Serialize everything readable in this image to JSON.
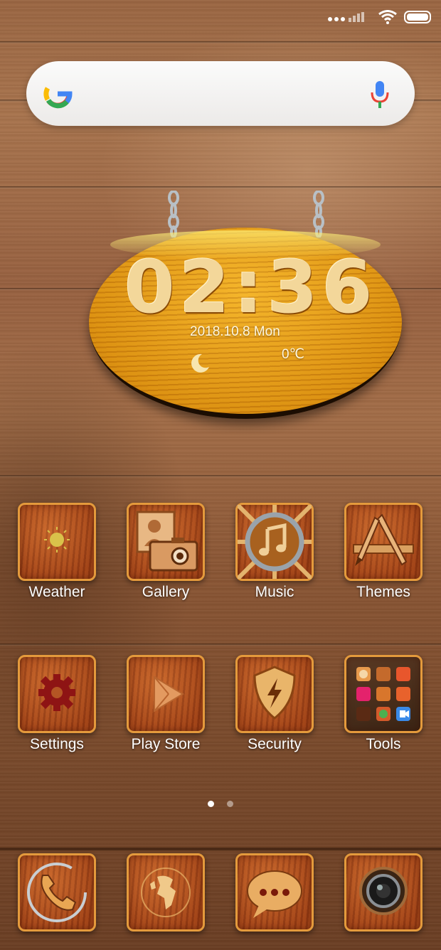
{
  "search": {
    "logo": "google-g-icon",
    "mic": "mic-icon"
  },
  "clock": {
    "time": "02:36",
    "date": "2018.10.8 Mon",
    "temperature": "0℃",
    "weather_icon": "moon-icon"
  },
  "apps_row1": [
    {
      "label": "Weather",
      "icon": "sun-icon"
    },
    {
      "label": "Gallery",
      "icon": "photo-camera-icon"
    },
    {
      "label": "Music",
      "icon": "music-note-icon"
    },
    {
      "label": "Themes",
      "icon": "brush-ruler-icon"
    }
  ],
  "apps_row2": [
    {
      "label": "Settings",
      "icon": "gear-icon"
    },
    {
      "label": "Play Store",
      "icon": "play-icon"
    },
    {
      "label": "Security",
      "icon": "shield-bolt-icon"
    },
    {
      "label": "Tools",
      "icon": "folder-icon"
    }
  ],
  "dock": [
    {
      "icon": "phone-icon"
    },
    {
      "icon": "browser-globe-icon"
    },
    {
      "icon": "messages-icon"
    },
    {
      "icon": "camera-icon"
    }
  ],
  "page_indicator": {
    "pages": 2,
    "active": 1
  },
  "colors": {
    "tile_border": "#e49a3c",
    "sign": "#f3b32c",
    "text": "#ffffff"
  }
}
